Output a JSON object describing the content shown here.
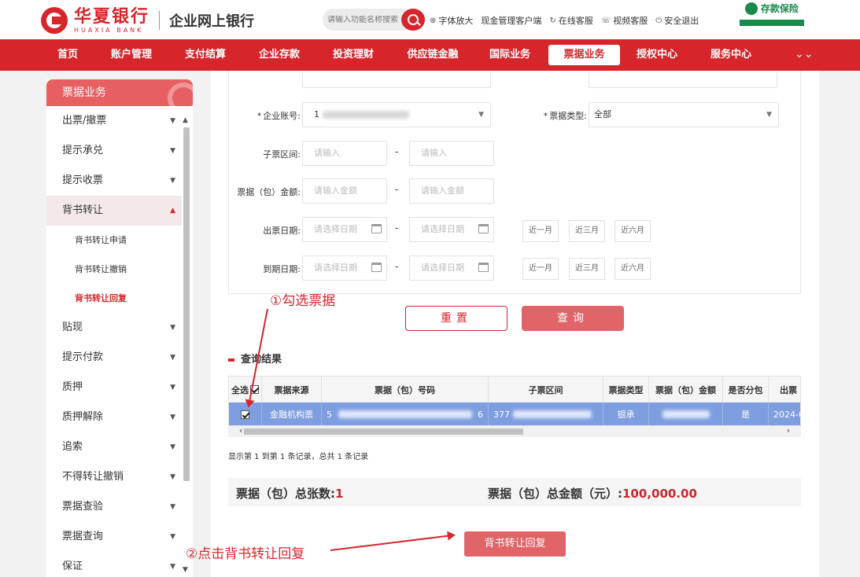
{
  "header": {
    "bank_name": "华夏银行",
    "bank_name_en": "HUAXIA BANK",
    "portal_title": "企业网上银行",
    "search_placeholder": "请输入功能名称搜索",
    "tools": [
      {
        "icon": "zoom-icon",
        "label": "字体放大"
      },
      {
        "icon": "",
        "label": "现金管理客户端"
      },
      {
        "icon": "refresh-icon",
        "label": "在线客服"
      },
      {
        "icon": "phone-icon",
        "label": "视频客服"
      },
      {
        "icon": "power-icon",
        "label": "安全退出"
      }
    ],
    "deposit_label": "存款保险"
  },
  "nav": {
    "items": [
      "首页",
      "账户管理",
      "支付结算",
      "企业存款",
      "投资理财",
      "供应链金融",
      "国际业务",
      "票据业务",
      "授权中心",
      "服务中心"
    ],
    "active": "票据业务",
    "more_icon": "double-chevron-down-icon"
  },
  "sidebar": {
    "title": "票据业务",
    "items": [
      {
        "label": "出票/撤票"
      },
      {
        "label": "提示承兑"
      },
      {
        "label": "提示收票"
      },
      {
        "label": "背书转让",
        "open": true,
        "children": [
          "背书转让申请",
          "背书转让撤销",
          "背书转让回复"
        ],
        "current": "背书转让回复"
      },
      {
        "label": "贴现"
      },
      {
        "label": "提示付款"
      },
      {
        "label": "质押"
      },
      {
        "label": "质押解除"
      },
      {
        "label": "追索"
      },
      {
        "label": "不得转让撤销"
      },
      {
        "label": "票据查验"
      },
      {
        "label": "票据查询"
      },
      {
        "label": "保证"
      }
    ]
  },
  "form": {
    "account_label": "企业账号:",
    "account_value": "1",
    "bill_type_label": "票据类型:",
    "bill_type_value": "全部",
    "sub_range_label": "子票区间:",
    "input_placeholder": "请输入",
    "amount_label": "票据（包）金额:",
    "amount_placeholder": "请输入金额",
    "issue_date_label": "出票日期:",
    "due_date_label": "到期日期:",
    "date_placeholder": "请选择日期",
    "dash": "-",
    "quick": [
      "近一月",
      "近三月",
      "近六月"
    ]
  },
  "buttons": {
    "reset": "重置",
    "query": "查询",
    "endorse_reply": "背书转让回复"
  },
  "results": {
    "title": "查询结果",
    "columns": [
      "全选",
      "票据来源",
      "票据（包）号码",
      "子票区间",
      "票据类型",
      "票据（包）金额",
      "是否分包",
      "出票"
    ],
    "row": {
      "source": "金融机构票",
      "bill_no_prefix": "5",
      "bill_no_suffix": "6",
      "sub_range_prefix": "377",
      "bill_type": "银承",
      "split": "是",
      "issue_date": "2024-0"
    },
    "page_info": "显示第 1 到第 1 条记录，总共 1 条记录"
  },
  "summary": {
    "count_label": "票据（包）总张数:",
    "count_value": "1",
    "amount_label": "票据（包）总金额（元）:",
    "amount_value": "100,000.00"
  },
  "annotations": {
    "step1": "①勾选票据",
    "step2": "②点击背书转让回复"
  },
  "colors": {
    "brand_red": "#d7252c",
    "button_red": "#e06468",
    "selected_row": "#7f9ee0"
  }
}
